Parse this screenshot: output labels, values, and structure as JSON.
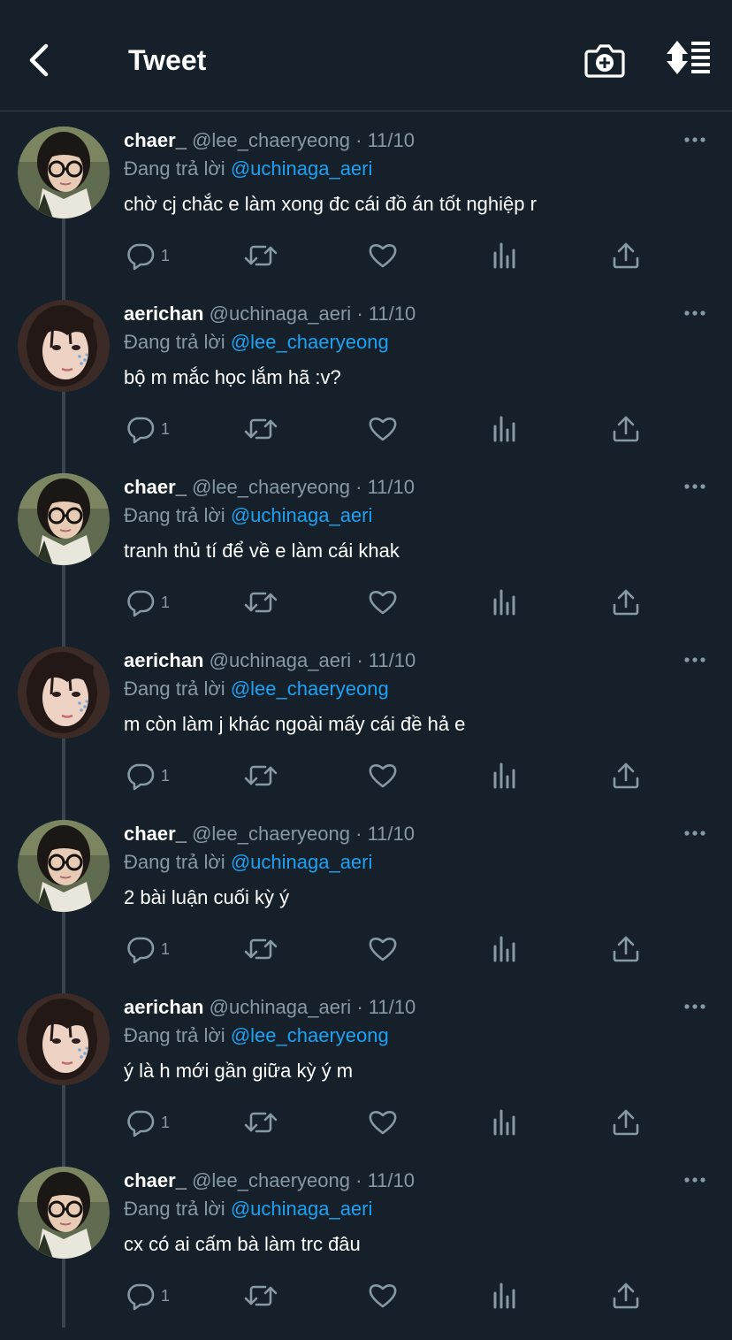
{
  "header": {
    "title": "Tweet",
    "back_icon": "chevron-left-icon",
    "camera_icon": "camera-plus-icon",
    "sort_icon": "sort-list-icon"
  },
  "colors": {
    "background": "#15202b",
    "divider": "#38444d",
    "secondary_text": "#8899a6",
    "link": "#1da1f2"
  },
  "reply_prefix": "Đang trả lời",
  "tweets": [
    {
      "name": "chaer_",
      "handle": "@lee_chaeryeong",
      "date": "11/10",
      "reply_to": "@uchinaga_aeri",
      "text": "chờ cj chắc e làm xong đc cái đồ án tốt nghiệp r",
      "replies": "1",
      "avatar": "glasses"
    },
    {
      "name": "aerichan",
      "handle": "@uchinaga_aeri",
      "date": "11/10",
      "reply_to": "@lee_chaeryeong",
      "text": "bộ m mắc học lắm hã :v?",
      "replies": "1",
      "avatar": "gems"
    },
    {
      "name": "chaer_",
      "handle": "@lee_chaeryeong",
      "date": "11/10",
      "reply_to": "@uchinaga_aeri",
      "text": "tranh thủ tí để về e làm cái khak",
      "replies": "1",
      "avatar": "glasses"
    },
    {
      "name": "aerichan",
      "handle": "@uchinaga_aeri",
      "date": "11/10",
      "reply_to": "@lee_chaeryeong",
      "text": "m còn làm j khác ngoài mấy cái đề hả e",
      "replies": "1",
      "avatar": "gems"
    },
    {
      "name": "chaer_",
      "handle": "@lee_chaeryeong",
      "date": "11/10",
      "reply_to": "@uchinaga_aeri",
      "text": "2 bài luận cuối kỳ ý",
      "replies": "1",
      "avatar": "glasses"
    },
    {
      "name": "aerichan",
      "handle": "@uchinaga_aeri",
      "date": "11/10",
      "reply_to": "@lee_chaeryeong",
      "text": "ý là h mới gần giữa kỳ ý m",
      "replies": "1",
      "avatar": "gems"
    },
    {
      "name": "chaer_",
      "handle": "@lee_chaeryeong",
      "date": "11/10",
      "reply_to": "@uchinaga_aeri",
      "text": "cx có ai cấm bà làm trc đâu",
      "replies": "1",
      "avatar": "glasses"
    }
  ]
}
